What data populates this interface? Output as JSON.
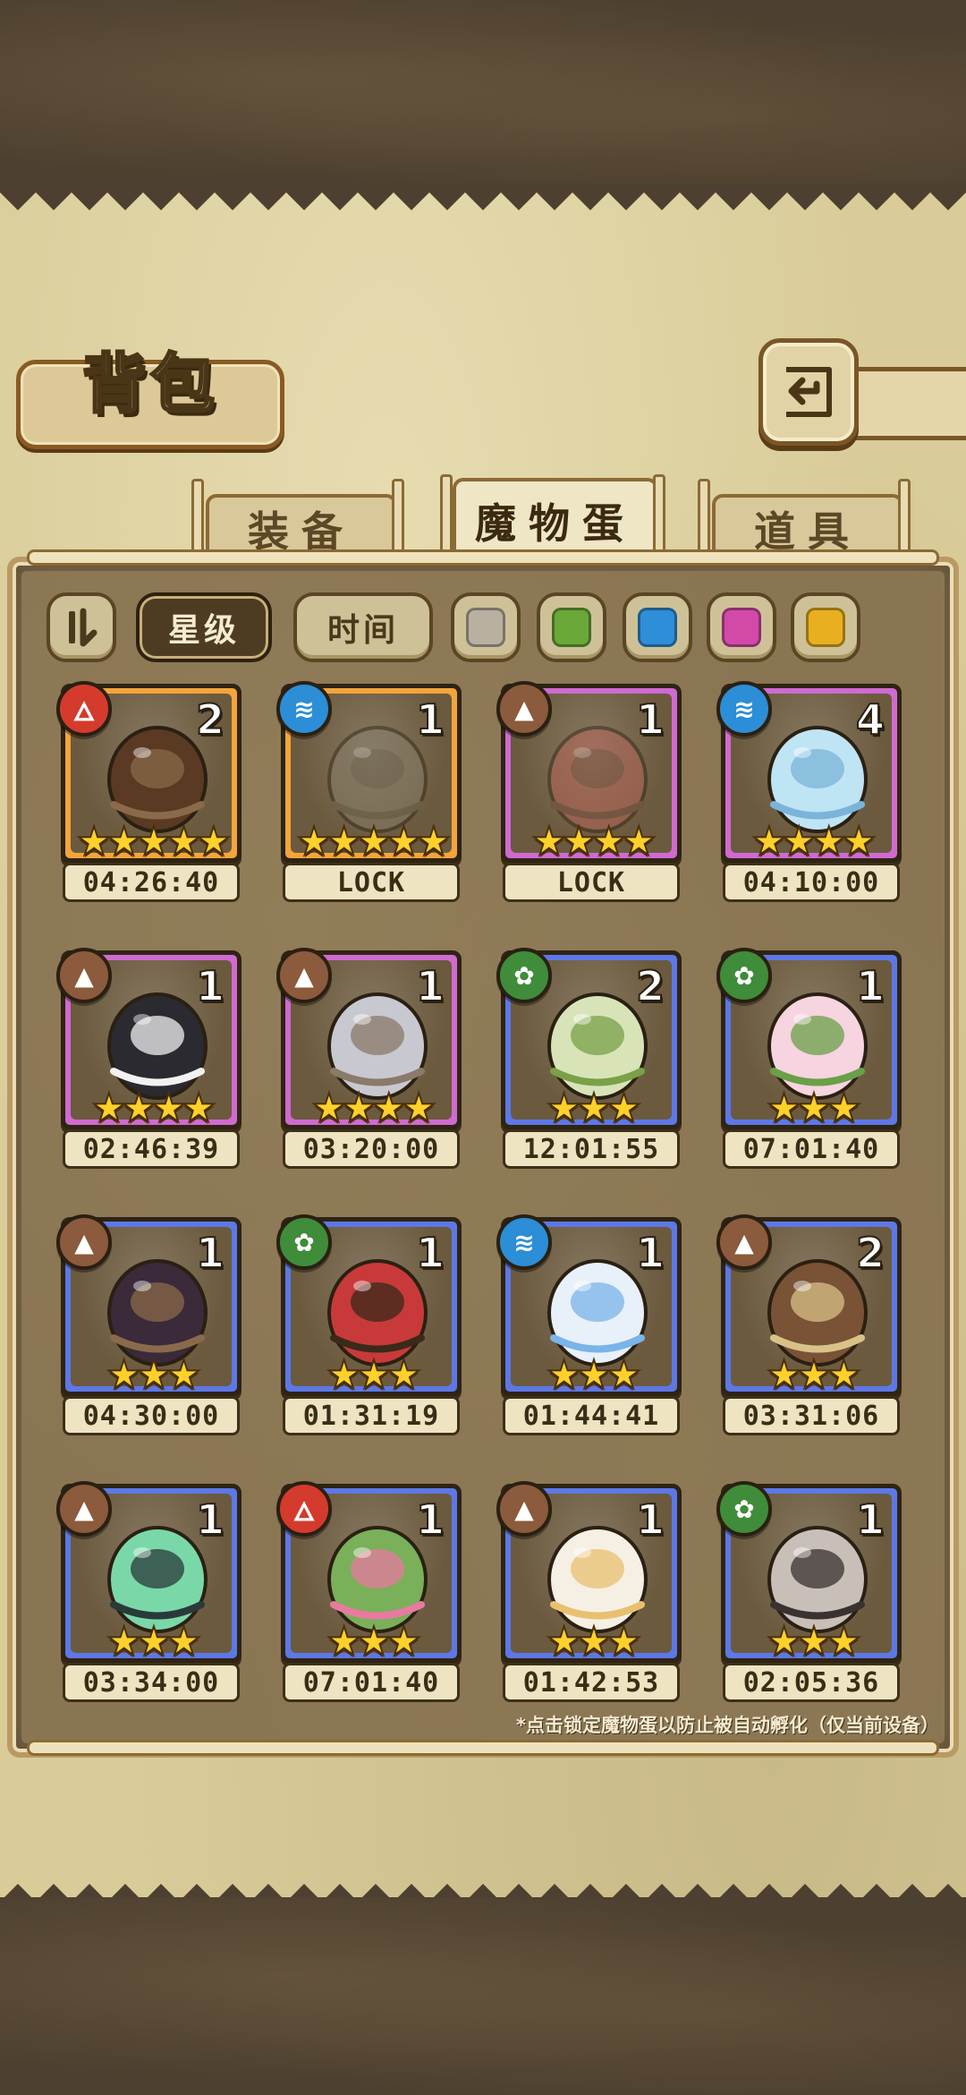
{
  "page": {
    "title": "背包",
    "back_icon": "return-arrow-icon"
  },
  "tabs": [
    {
      "label": "装备",
      "active": false
    },
    {
      "label": "魔物蛋",
      "active": true
    },
    {
      "label": "道具",
      "active": false
    }
  ],
  "filters": {
    "sort_toggle_icon": "sort-toggle-icon",
    "star_label": "星级",
    "time_label": "时间",
    "colors": [
      "#b8b0a0",
      "#6aa83a",
      "#2f8ed8",
      "#d24aa8",
      "#e8b020"
    ]
  },
  "eggs": [
    {
      "name": "bow-egg",
      "element": "fire",
      "rarity": "orange",
      "count": "2",
      "stars": "★★★★★",
      "timer": "04:26:40"
    },
    {
      "name": "locked-shadow-egg",
      "element": "water",
      "rarity": "orange",
      "count": "1",
      "stars": "★★★★★",
      "timer": "LOCK"
    },
    {
      "name": "thorn-egg",
      "element": "earth",
      "rarity": "purple",
      "count": "1",
      "stars": "★★★★",
      "timer": "LOCK"
    },
    {
      "name": "water-spirit-egg",
      "element": "water",
      "rarity": "purple",
      "count": "4",
      "stars": "★★★★",
      "timer": "04:10:00"
    },
    {
      "name": "spider-egg",
      "element": "earth",
      "rarity": "purple",
      "count": "1",
      "stars": "★★★★",
      "timer": "02:46:39"
    },
    {
      "name": "knight-sword-egg",
      "element": "earth",
      "rarity": "purple",
      "count": "1",
      "stars": "★★★★",
      "timer": "03:20:00"
    },
    {
      "name": "leaf-swirl-egg",
      "element": "grass",
      "rarity": "blue",
      "count": "2",
      "stars": "★★★",
      "timer": "12:01:55"
    },
    {
      "name": "lotus-egg",
      "element": "grass",
      "rarity": "blue",
      "count": "1",
      "stars": "★★★",
      "timer": "07:01:40"
    },
    {
      "name": "bat-wing-egg",
      "element": "earth",
      "rarity": "blue",
      "count": "1",
      "stars": "★★★",
      "timer": "04:30:00"
    },
    {
      "name": "spotted-feather-egg",
      "element": "grass",
      "rarity": "blue",
      "count": "1",
      "stars": "★★★",
      "timer": "01:31:19"
    },
    {
      "name": "cloud-wing-egg",
      "element": "water",
      "rarity": "blue",
      "count": "1",
      "stars": "★★★",
      "timer": "01:44:41"
    },
    {
      "name": "acorn-berry-egg",
      "element": "earth",
      "rarity": "blue",
      "count": "2",
      "stars": "★★★",
      "timer": "03:31:06"
    },
    {
      "name": "slime-egg",
      "element": "earth",
      "rarity": "blue",
      "count": "1",
      "stars": "★★★",
      "timer": "03:34:00"
    },
    {
      "name": "cactus-flower-egg",
      "element": "fire",
      "rarity": "blue",
      "count": "1",
      "stars": "★★★",
      "timer": "07:01:40"
    },
    {
      "name": "fluffy-bee-egg",
      "element": "earth",
      "rarity": "blue",
      "count": "1",
      "stars": "★★★",
      "timer": "01:42:53"
    },
    {
      "name": "spiked-collar-egg",
      "element": "grass",
      "rarity": "blue",
      "count": "1",
      "stars": "★★★",
      "timer": "02:05:36"
    }
  ],
  "footer_note": "*点击锁定魔物蛋以防止被自动孵化（仅当前设备）"
}
